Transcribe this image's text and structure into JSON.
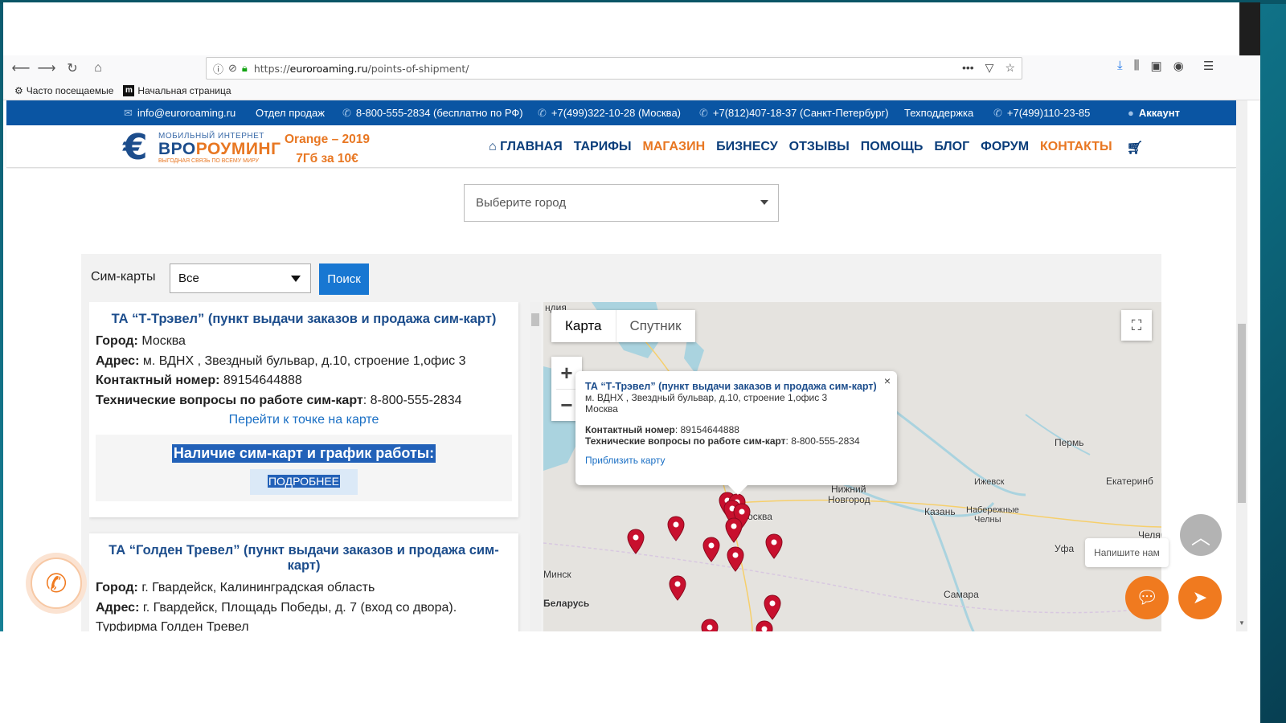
{
  "browser": {
    "url_prefix": "https://",
    "url_host": "euroroaming.ru",
    "url_path": "/points-of-shipment/",
    "bookmarks": [
      "Часто посещаемые",
      "Начальная страница"
    ]
  },
  "topbar": {
    "email": "info@euroroaming.ru",
    "sales_label": "Отдел продаж",
    "phone_free": "8-800-555-2834 (бесплатно по РФ)",
    "phone_msk": "+7(499)322-10-28 (Москва)",
    "phone_spb": "+7(812)407-18-37 (Санкт-Петербург)",
    "support_label": "Техподдержка",
    "phone_support": "+7(499)110-23-85",
    "account": "Аккаунт"
  },
  "logo": {
    "small": "МОБИЛЬНЫЙ ИНТЕРНЕТ",
    "big_a": "ВРО",
    "big_b": "РОУМИНГ",
    "tagline": "ВЫГОДНАЯ СВЯЗЬ ПО ВСЕМУ МИРУ"
  },
  "promo": {
    "line1": "Orange – 2019",
    "line2": "7Гб за 10€"
  },
  "nav": {
    "home": "ГЛАВНАЯ",
    "tariffs": "ТАРИФЫ",
    "shop": "МАГАЗИН",
    "business": "БИЗНЕСУ",
    "reviews": "ОТЗЫВЫ",
    "help": "ПОМОЩЬ",
    "blog": "БЛОГ",
    "forum": "ФОРУМ",
    "contacts": "КОНТАКТЫ"
  },
  "city_select": {
    "placeholder": "Выберите город"
  },
  "filter": {
    "label": "Сим-карты",
    "value": "Все",
    "button": "Поиск"
  },
  "cards": [
    {
      "title": "ТА “Т-Трэвел” (пункт выдачи заказов и продажа сим-карт)",
      "city_label": "Город:",
      "city": " Москва",
      "address_label": "Адрес:",
      "address": " м. ВДНХ , Звездный бульвар, д.10, строение 1,офис 3",
      "contact_label": "Контактный номер:",
      "contact": " 89154644888",
      "tech_label": "Технические вопросы по работе сим-карт",
      "tech": ": 8-800-555-2834",
      "link": "Перейти к точке на карте",
      "availability": "Наличие сим-карт и график работы:",
      "more": "ПОДРОБНЕЕ"
    },
    {
      "title": "ТА “Голден Тревел” (пункт выдачи заказов и продажа сим-карт)",
      "city_label": "Город:",
      "city": " г. Гвардейск, Калининградская область",
      "address_label": "Адрес:",
      "address": " г. Гвардейск, Площадь Победы, д. 7 (вход со двора).",
      "extra": "Турфирма Голден Тревел"
    }
  ],
  "map": {
    "tab_map": "Карта",
    "tab_satellite": "Спутник",
    "zoom_in": "+",
    "zoom_out": "−",
    "labels": [
      "Пермь",
      "Ижевск",
      "Екатеринб",
      "Набережные",
      "Челны",
      "Казань",
      "Нижний",
      "Новгород",
      "Уфа",
      "Челяб",
      "Минск",
      "Беларусь",
      "Самара",
      "Москва",
      "ндия"
    ],
    "info": {
      "title": "ТА “Т-Трэвел” (пункт выдачи заказов и продажа сим-карт)",
      "address_1": "м. ВДНХ , Звездный бульвар, д.10, строение 1,офис 3",
      "address_2": "Москва",
      "contact_label": "Контактный номер",
      "contact": ": 89154644888",
      "tech_label": "Технические вопросы по работе сим-карт",
      "tech": ": 8-800-555-2834",
      "zoom_link": "Приблизить карту",
      "close": "×"
    }
  },
  "widgets": {
    "write_us": "Напишите нам"
  },
  "colors": {
    "brand_blue": "#0a55a3",
    "accent_orange": "#e87722",
    "pin_red": "#c8102e"
  }
}
